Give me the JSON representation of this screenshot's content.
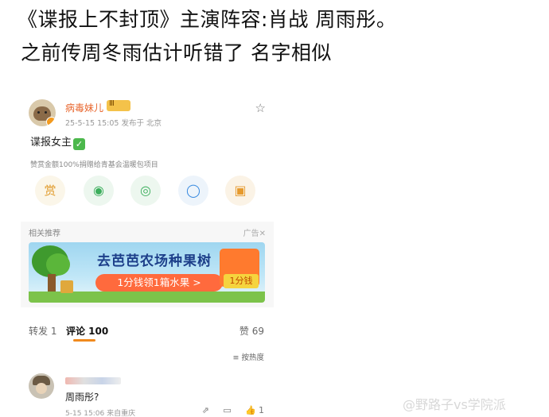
{
  "caption": {
    "line1": "《谍报上不封顶》主演阵容:肖战 周雨彤。",
    "line2": "之前传周冬雨估计听错了 名字相似"
  },
  "post": {
    "username": "病毒妹儿",
    "level_badge": "Ⅲ",
    "meta": "25-5-15 15:05  发布于 北京",
    "text": "谍报女主",
    "check_mark": "✓",
    "sponsor_note": "赞赏金额100%捐赠给青基会温暖包项目",
    "star_icon": "star-outline-icon",
    "actions": [
      {
        "label": "赏",
        "icon": "reward-icon"
      },
      {
        "label": "◉",
        "icon": "wechat-icon"
      },
      {
        "label": "◎",
        "icon": "moments-icon"
      },
      {
        "label": "◯",
        "icon": "qq-icon"
      },
      {
        "label": "▣",
        "icon": "save-image-icon"
      }
    ]
  },
  "recommend": {
    "title": "相关推荐",
    "ad_label": "广告✕",
    "banner_title": "去芭芭农场种果树",
    "banner_cta": "1分钱领1箱水果 >",
    "banner_price": "1分钱"
  },
  "tabs": {
    "repost": "转发 1",
    "comments": "评论 100",
    "likes": "赞 69",
    "accent_color": "#f08a1e"
  },
  "sort_label": "≡ 按热度",
  "comment": {
    "text": "周雨彤?",
    "meta": "5-15 15:06  来自重庆",
    "like_count": "1",
    "share_icon": "share-icon",
    "reply_icon": "reply-icon",
    "like_icon": "thumb-up-icon"
  },
  "watermark": "@野路子vs学院派"
}
